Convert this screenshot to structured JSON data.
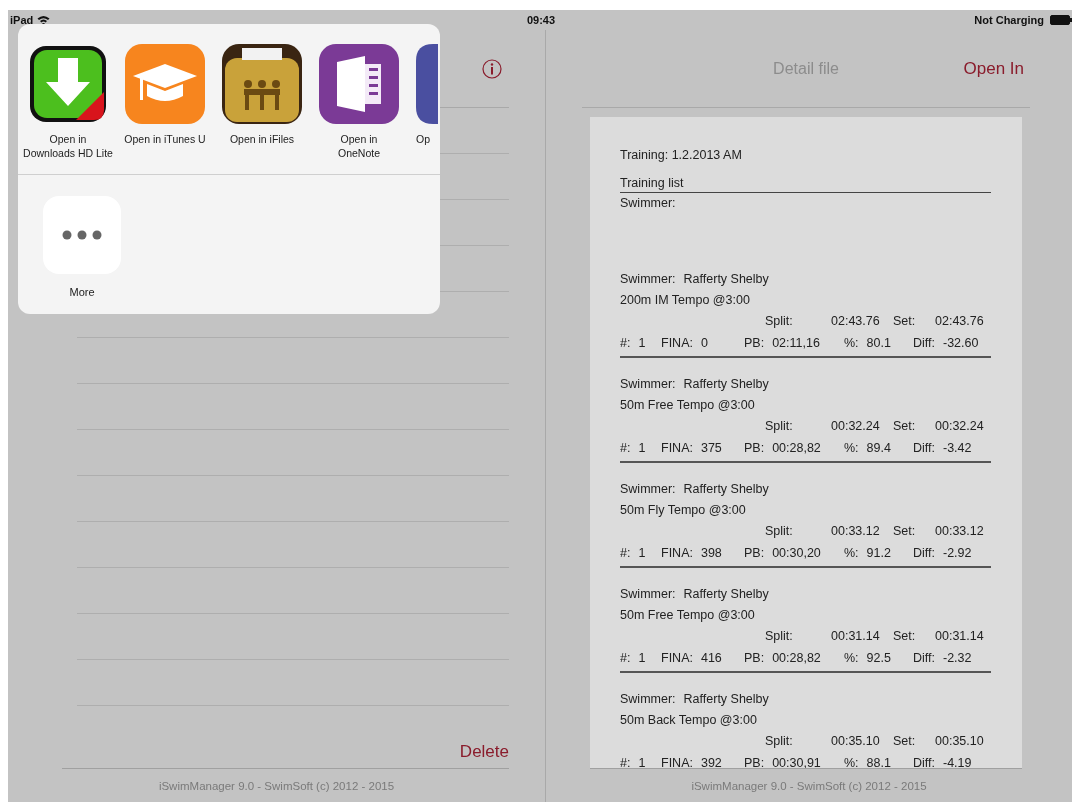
{
  "status_bar": {
    "device": "iPad",
    "time": "09:43",
    "battery": "Not Charging"
  },
  "share_sheet": {
    "apps": [
      {
        "kind": "downloads",
        "label": "Open in\nDownloads HD Lite"
      },
      {
        "kind": "itunes-u",
        "label": "Open in iTunes U"
      },
      {
        "kind": "ifiles",
        "label": "Open in iFiles"
      },
      {
        "kind": "onenote",
        "label": "Open in\nOneNote"
      },
      {
        "kind": "partial",
        "label": "Op"
      }
    ],
    "actions": [
      {
        "label": "More"
      }
    ]
  },
  "left_pane": {
    "delete_button": "Delete",
    "footer": "iSwimManager 9.0 - SwimSoft (c) 2012 - 2015"
  },
  "right_pane": {
    "title": "Detail file",
    "open_in": "Open In",
    "footer": "iSwimManager 9.0 - SwimSoft (c) 2012 - 2015",
    "document": {
      "title": "Training: 1.2.2013 AM",
      "list_heading": "Training list",
      "swimmer_heading": "Swimmer:",
      "entries": [
        {
          "swimmer_label": "Swimmer:",
          "swimmer": "Rafferty Shelby",
          "event": "200m IM Tempo @3:00",
          "split_label": "Split:",
          "split": "02:43.76",
          "set_label": "Set:",
          "set": "02:43.76",
          "stats": [
            {
              "label": "#:",
              "value": "1"
            },
            {
              "label": "FINA:",
              "value": "0"
            },
            {
              "label": "PB:",
              "value": "02:11,16"
            },
            {
              "label": "%:",
              "value": "80.1"
            },
            {
              "label": "Diff:",
              "value": "-32.60"
            }
          ]
        },
        {
          "swimmer_label": "Swimmer:",
          "swimmer": "Rafferty Shelby",
          "event": "50m Free Tempo @3:00",
          "split_label": "Split:",
          "split": "00:32.24",
          "set_label": "Set:",
          "set": "00:32.24",
          "stats": [
            {
              "label": "#:",
              "value": "1"
            },
            {
              "label": "FINA:",
              "value": "375"
            },
            {
              "label": "PB:",
              "value": "00:28,82"
            },
            {
              "label": "%:",
              "value": "89.4"
            },
            {
              "label": "Diff:",
              "value": "-3.42"
            }
          ]
        },
        {
          "swimmer_label": "Swimmer:",
          "swimmer": "Rafferty Shelby",
          "event": "50m Fly Tempo @3:00",
          "split_label": "Split:",
          "split": "00:33.12",
          "set_label": "Set:",
          "set": "00:33.12",
          "stats": [
            {
              "label": "#:",
              "value": "1"
            },
            {
              "label": "FINA:",
              "value": "398"
            },
            {
              "label": "PB:",
              "value": "00:30,20"
            },
            {
              "label": "%:",
              "value": "91.2"
            },
            {
              "label": "Diff:",
              "value": "-2.92"
            }
          ]
        },
        {
          "swimmer_label": "Swimmer:",
          "swimmer": "Rafferty Shelby",
          "event": "50m Free Tempo @3:00",
          "split_label": "Split:",
          "split": "00:31.14",
          "set_label": "Set:",
          "set": "00:31.14",
          "stats": [
            {
              "label": "#:",
              "value": "1"
            },
            {
              "label": "FINA:",
              "value": "416"
            },
            {
              "label": "PB:",
              "value": "00:28,82"
            },
            {
              "label": "%:",
              "value": "92.5"
            },
            {
              "label": "Diff:",
              "value": "-2.32"
            }
          ]
        },
        {
          "swimmer_label": "Swimmer:",
          "swimmer": "Rafferty Shelby",
          "event": "50m Back Tempo @3:00",
          "split_label": "Split:",
          "split": "00:35.10",
          "set_label": "Set:",
          "set": "00:35.10",
          "stats": [
            {
              "label": "#:",
              "value": "1"
            },
            {
              "label": "FINA:",
              "value": "392"
            },
            {
              "label": "PB:",
              "value": "00:30,91"
            },
            {
              "label": "%:",
              "value": "88.1"
            },
            {
              "label": "Diff:",
              "value": "-4.19"
            }
          ]
        }
      ]
    }
  }
}
